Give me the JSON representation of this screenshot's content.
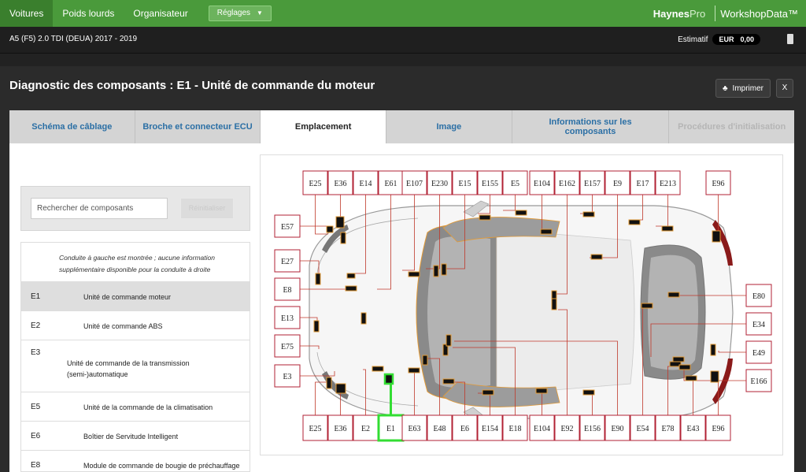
{
  "nav": {
    "tabs": [
      "Voitures",
      "Poids lourds",
      "Organisateur"
    ],
    "settings_label": "Réglages",
    "brand_haynes": "Haynes",
    "brand_pro": "Pro",
    "brand_workshop": "WorkshopData™"
  },
  "vehicle": {
    "name": "A5 (F5) 2.0 TDI (DEUA) 2017 - 2019",
    "estimate_label": "Estimatif",
    "currency": "EUR",
    "amount": "0,00"
  },
  "page": {
    "title": "Diagnostic des composants : E1 - Unité de commande du moteur",
    "print_label": "Imprimer",
    "close_label": "X"
  },
  "tabs": [
    {
      "label": "Schéma de câblage",
      "state": "normal"
    },
    {
      "label": "Broche et connecteur ECU",
      "state": "normal"
    },
    {
      "label": "Emplacement",
      "state": "active"
    },
    {
      "label": "Image",
      "state": "normal"
    },
    {
      "label": "Informations sur les composants",
      "state": "normal"
    },
    {
      "label": "Procédures d'initialisation",
      "state": "disabled"
    }
  ],
  "search": {
    "placeholder": "Rechercher de composants",
    "reset_label": "Réinitialiser"
  },
  "components": {
    "note": "Conduite à gauche est montrée ; aucune information supplémentaire disponible pour la conduite à droite",
    "items": [
      {
        "code": "E1",
        "name": "Unité de commande moteur",
        "selected": true
      },
      {
        "code": "E2",
        "name": "Unité de commande ABS",
        "selected": false
      },
      {
        "code": "E3",
        "name": "Unité de commande de la transmission (semi-)automatique",
        "selected": false
      },
      {
        "code": "E5",
        "name": "Unité de la commande de la climatisation",
        "selected": false
      },
      {
        "code": "E6",
        "name": "Boîtier de Servitude Intelligent",
        "selected": false
      },
      {
        "code": "E8",
        "name": "Module de commande de bougie de préchauffage",
        "selected": false
      }
    ]
  },
  "diagram": {
    "top_labels": [
      "E25",
      "E36",
      "E14",
      "E61",
      "E107",
      "E230",
      "E15",
      "E155",
      "E5",
      "E104",
      "E162",
      "E157",
      "E9",
      "E17",
      "E213",
      "E96"
    ],
    "bottom_labels": [
      "E25",
      "E36",
      "E2",
      "E1",
      "E63",
      "E48",
      "E6",
      "E154",
      "E18",
      "E104",
      "E92",
      "E156",
      "E90",
      "E54",
      "E78",
      "E43",
      "E96"
    ],
    "left_labels": [
      "E57",
      "E27",
      "E8",
      "E13",
      "E75",
      "E3"
    ],
    "right_labels": [
      "E80",
      "E34",
      "E49",
      "E166"
    ],
    "highlight": "E1",
    "highlight_color": "#33dd33",
    "label_border_color": "#b22234"
  }
}
